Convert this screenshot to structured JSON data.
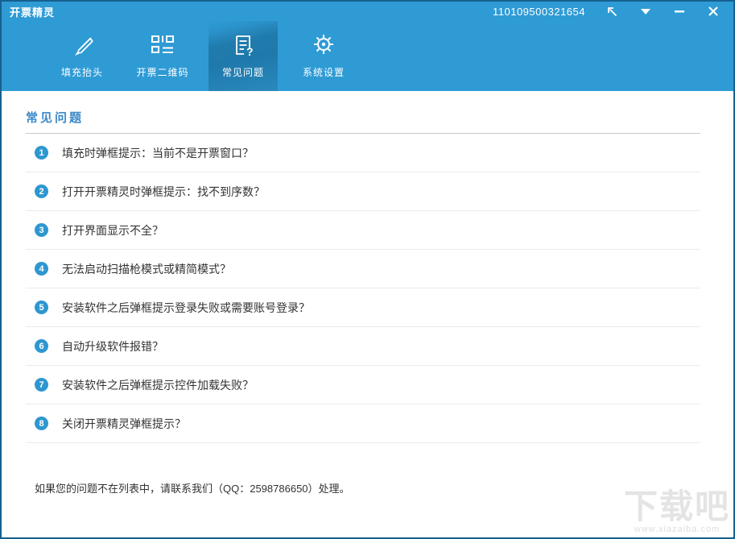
{
  "window": {
    "title": "开票精灵",
    "serial": "110109500321654"
  },
  "nav": {
    "tabs": [
      {
        "label": "填充抬头",
        "icon": "pencil-icon",
        "active": false
      },
      {
        "label": "开票二维码",
        "icon": "qrcode-icon",
        "active": false
      },
      {
        "label": "常见问题",
        "icon": "faq-document-icon",
        "active": true
      },
      {
        "label": "系统设置",
        "icon": "gear-icon",
        "active": false
      }
    ]
  },
  "main": {
    "section_title": "常见问题",
    "faq": [
      {
        "num": "1",
        "question": "填充时弹框提示：当前不是开票窗口？"
      },
      {
        "num": "2",
        "question": "打开开票精灵时弹框提示：找不到序数？"
      },
      {
        "num": "3",
        "question": "打开界面显示不全？"
      },
      {
        "num": "4",
        "question": "无法启动扫描枪模式或精简模式？"
      },
      {
        "num": "5",
        "question": "安装软件之后弹框提示登录失败或需要账号登录？"
      },
      {
        "num": "6",
        "question": "自动升级软件报错？"
      },
      {
        "num": "7",
        "question": "安装软件之后弹框提示控件加载失败？"
      },
      {
        "num": "8",
        "question": "关闭开票精灵弹框提示？"
      }
    ],
    "contact_note": "如果您的问题不在列表中，请联系我们（QQ：2598786650）处理。"
  },
  "watermark": {
    "logo": "下载吧",
    "url": "www.xiazaiba.com"
  },
  "colors": {
    "header_blue": "#2f9bd5",
    "active_tab_blue": "#1f79ab",
    "window_border_blue": "#15618f",
    "badge_blue": "#2e97d0",
    "section_title_blue": "#3a87c8"
  }
}
